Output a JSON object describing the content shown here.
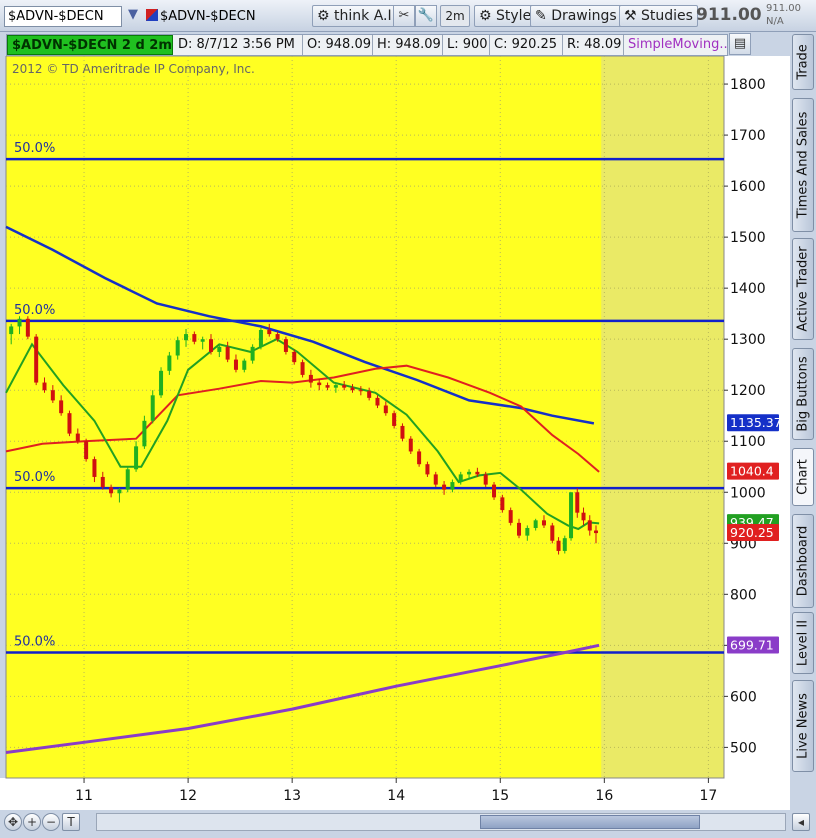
{
  "toolbar": {
    "symbol_1": "$ADVN-$DECN",
    "symbol_2": "$ADVN-$DECN",
    "think_ai": "think A.I.",
    "aggregation": "2m",
    "style": "Style",
    "drawings": "Drawings",
    "studies": "Studies",
    "last_price": "911.00",
    "last_small": "911.00",
    "last_na": "N/A"
  },
  "infobar": {
    "title": "$ADVN-$DECN 2 d 2m",
    "date": "D: 8/7/12 3:56 PM",
    "open": "O: 948.09",
    "high": "H: 948.09",
    "low": "L: 900",
    "close": "C: 920.25",
    "range": "R: 48.09",
    "study": "SimpleMoving..."
  },
  "copyright": "2012 © TD Ameritrade IP Company, Inc.",
  "colors": {
    "chart_bg": "#ffff22",
    "expansion_bg": "#eaea66",
    "fib": "#1020cc",
    "ma_blue": "#1530c8",
    "ma_red": "#e02020",
    "ma_green": "#22a022",
    "ma_purple": "#8a3cc8",
    "candle_up": "#20b020",
    "candle_down": "#d01010"
  },
  "chart_data": {
    "type": "candlestick",
    "y_axis": {
      "ticks": [
        500,
        600,
        700,
        800,
        900,
        1000,
        1100,
        1200,
        1300,
        1400,
        1500,
        1600,
        1700,
        1800
      ],
      "range": [
        440,
        1855
      ]
    },
    "x_axis": {
      "ticks": [
        "11",
        "12",
        "13",
        "14",
        "15",
        "16",
        "17"
      ],
      "range": [
        10.25,
        17.15
      ]
    },
    "fib_levels": [
      {
        "label": "50.0%",
        "value": 1653
      },
      {
        "label": "50.0%",
        "value": 1336
      },
      {
        "label": "50.0%",
        "value": 1008
      },
      {
        "label": "50.0%",
        "value": 686
      }
    ],
    "badges": [
      {
        "value": 1135.37,
        "text": "1135.37",
        "color": "#1530c8"
      },
      {
        "value": 1040.4,
        "text": "1040.4",
        "color": "#e02020"
      },
      {
        "value": 939.47,
        "text": "939.47",
        "color": "#22a022"
      },
      {
        "value": 920.25,
        "text": "920.25",
        "color": "#e02020"
      },
      {
        "value": 699.71,
        "text": "699.71",
        "color": "#8a3cc8"
      }
    ],
    "series": [
      {
        "name": "ma_blue",
        "points": [
          [
            10.25,
            1520
          ],
          [
            10.7,
            1475
          ],
          [
            11.2,
            1420
          ],
          [
            11.7,
            1370
          ],
          [
            12.2,
            1345
          ],
          [
            12.7,
            1325
          ],
          [
            13.2,
            1295
          ],
          [
            13.7,
            1255
          ],
          [
            14.2,
            1220
          ],
          [
            14.7,
            1180
          ],
          [
            15.2,
            1165
          ],
          [
            15.5,
            1150
          ],
          [
            15.9,
            1135
          ]
        ]
      },
      {
        "name": "ma_red",
        "points": [
          [
            10.25,
            1080
          ],
          [
            10.6,
            1095
          ],
          [
            11.0,
            1100
          ],
          [
            11.5,
            1105
          ],
          [
            11.9,
            1190
          ],
          [
            12.3,
            1203
          ],
          [
            12.7,
            1218
          ],
          [
            13.0,
            1215
          ],
          [
            13.4,
            1225
          ],
          [
            13.8,
            1242
          ],
          [
            14.1,
            1248
          ],
          [
            14.5,
            1225
          ],
          [
            14.9,
            1195
          ],
          [
            15.2,
            1168
          ],
          [
            15.5,
            1112
          ],
          [
            15.75,
            1075
          ],
          [
            15.95,
            1040
          ]
        ]
      },
      {
        "name": "ma_green",
        "points": [
          [
            10.25,
            1195
          ],
          [
            10.5,
            1290
          ],
          [
            10.8,
            1210
          ],
          [
            11.1,
            1140
          ],
          [
            11.35,
            1050
          ],
          [
            11.55,
            1050
          ],
          [
            11.8,
            1140
          ],
          [
            12.0,
            1240
          ],
          [
            12.3,
            1290
          ],
          [
            12.6,
            1275
          ],
          [
            12.85,
            1300
          ],
          [
            13.05,
            1275
          ],
          [
            13.4,
            1215
          ],
          [
            13.8,
            1195
          ],
          [
            14.1,
            1152
          ],
          [
            14.4,
            1080
          ],
          [
            14.6,
            1020
          ],
          [
            14.8,
            1033
          ],
          [
            15.0,
            1038
          ],
          [
            15.2,
            1005
          ],
          [
            15.45,
            958
          ],
          [
            15.65,
            935
          ],
          [
            15.75,
            928
          ],
          [
            15.85,
            941
          ],
          [
            15.95,
            939
          ]
        ]
      },
      {
        "name": "ma_purple",
        "points": [
          [
            10.25,
            490
          ],
          [
            11.0,
            510
          ],
          [
            12.0,
            537
          ],
          [
            13.0,
            575
          ],
          [
            14.0,
            620
          ],
          [
            15.0,
            660
          ],
          [
            15.6,
            685
          ],
          [
            15.95,
            700
          ]
        ]
      }
    ],
    "candles": [
      [
        10.3,
        1310,
        1330,
        1290,
        1325
      ],
      [
        10.38,
        1325,
        1345,
        1310,
        1340
      ],
      [
        10.46,
        1340,
        1345,
        1300,
        1305
      ],
      [
        10.54,
        1305,
        1310,
        1210,
        1215
      ],
      [
        10.62,
        1215,
        1225,
        1195,
        1200
      ],
      [
        10.7,
        1200,
        1210,
        1175,
        1180
      ],
      [
        10.78,
        1180,
        1190,
        1150,
        1155
      ],
      [
        10.86,
        1155,
        1160,
        1110,
        1115
      ],
      [
        10.94,
        1115,
        1125,
        1095,
        1100
      ],
      [
        11.02,
        1100,
        1105,
        1060,
        1065
      ],
      [
        11.1,
        1065,
        1070,
        1020,
        1030
      ],
      [
        11.18,
        1030,
        1040,
        1005,
        1010
      ],
      [
        11.26,
        1010,
        1015,
        990,
        998
      ],
      [
        11.34,
        998,
        1008,
        980,
        1005
      ],
      [
        11.42,
        1005,
        1050,
        1000,
        1045
      ],
      [
        11.5,
        1045,
        1100,
        1040,
        1090
      ],
      [
        11.58,
        1090,
        1150,
        1085,
        1140
      ],
      [
        11.66,
        1140,
        1200,
        1135,
        1190
      ],
      [
        11.74,
        1190,
        1245,
        1185,
        1238
      ],
      [
        11.82,
        1238,
        1275,
        1230,
        1268
      ],
      [
        11.9,
        1268,
        1305,
        1260,
        1298
      ],
      [
        11.98,
        1298,
        1320,
        1285,
        1310
      ],
      [
        12.06,
        1310,
        1315,
        1290,
        1295
      ],
      [
        12.14,
        1295,
        1305,
        1280,
        1300
      ],
      [
        12.22,
        1300,
        1310,
        1270,
        1275
      ],
      [
        12.3,
        1275,
        1290,
        1265,
        1285
      ],
      [
        12.38,
        1285,
        1295,
        1255,
        1260
      ],
      [
        12.46,
        1260,
        1270,
        1235,
        1240
      ],
      [
        12.54,
        1240,
        1262,
        1235,
        1258
      ],
      [
        12.62,
        1258,
        1290,
        1252,
        1285
      ],
      [
        12.7,
        1285,
        1322,
        1280,
        1318
      ],
      [
        12.78,
        1318,
        1330,
        1305,
        1310
      ],
      [
        12.86,
        1310,
        1315,
        1295,
        1300
      ],
      [
        12.94,
        1300,
        1305,
        1270,
        1275
      ],
      [
        13.02,
        1275,
        1280,
        1250,
        1255
      ],
      [
        13.1,
        1255,
        1260,
        1225,
        1230
      ],
      [
        13.18,
        1230,
        1240,
        1205,
        1215
      ],
      [
        13.26,
        1215,
        1222,
        1200,
        1210
      ],
      [
        13.34,
        1210,
        1215,
        1200,
        1205
      ],
      [
        13.42,
        1205,
        1215,
        1195,
        1210
      ],
      [
        13.5,
        1210,
        1218,
        1200,
        1205
      ],
      [
        13.58,
        1205,
        1212,
        1195,
        1200
      ],
      [
        13.66,
        1200,
        1208,
        1190,
        1198
      ],
      [
        13.74,
        1198,
        1205,
        1180,
        1185
      ],
      [
        13.82,
        1185,
        1190,
        1165,
        1170
      ],
      [
        13.9,
        1170,
        1178,
        1150,
        1155
      ],
      [
        13.98,
        1155,
        1160,
        1125,
        1130
      ],
      [
        14.06,
        1130,
        1135,
        1100,
        1105
      ],
      [
        14.14,
        1105,
        1110,
        1075,
        1080
      ],
      [
        14.22,
        1080,
        1085,
        1050,
        1055
      ],
      [
        14.3,
        1055,
        1060,
        1030,
        1035
      ],
      [
        14.38,
        1035,
        1040,
        1010,
        1015
      ],
      [
        14.46,
        1015,
        1022,
        995,
        1005
      ],
      [
        14.54,
        1005,
        1025,
        1000,
        1020
      ],
      [
        14.62,
        1020,
        1040,
        1015,
        1035
      ],
      [
        14.7,
        1035,
        1045,
        1025,
        1040
      ],
      [
        14.78,
        1040,
        1048,
        1030,
        1035
      ],
      [
        14.86,
        1035,
        1040,
        1010,
        1015
      ],
      [
        14.94,
        1015,
        1020,
        985,
        990
      ],
      [
        15.02,
        990,
        995,
        960,
        965
      ],
      [
        15.1,
        965,
        970,
        935,
        940
      ],
      [
        15.18,
        940,
        948,
        910,
        915
      ],
      [
        15.26,
        915,
        935,
        905,
        930
      ],
      [
        15.34,
        930,
        948,
        925,
        945
      ],
      [
        15.42,
        945,
        955,
        930,
        935
      ],
      [
        15.5,
        935,
        940,
        900,
        905
      ],
      [
        15.56,
        905,
        912,
        878,
        885
      ],
      [
        15.62,
        885,
        915,
        880,
        910
      ],
      [
        15.68,
        910,
        1000,
        905,
        1000
      ],
      [
        15.74,
        1000,
        1008,
        950,
        960
      ],
      [
        15.8,
        960,
        970,
        935,
        945
      ],
      [
        15.86,
        945,
        955,
        915,
        925
      ],
      [
        15.92,
        925,
        935,
        900,
        920
      ]
    ]
  },
  "side_tabs": [
    "Trade",
    "Times And Sales",
    "Active Trader",
    "Big Buttons",
    "Chart",
    "Dashboard",
    "Level II",
    "Live News"
  ],
  "bottom": {
    "zoom_in": "+",
    "zoom_out": "−",
    "pan": "◂",
    "type": "T"
  }
}
